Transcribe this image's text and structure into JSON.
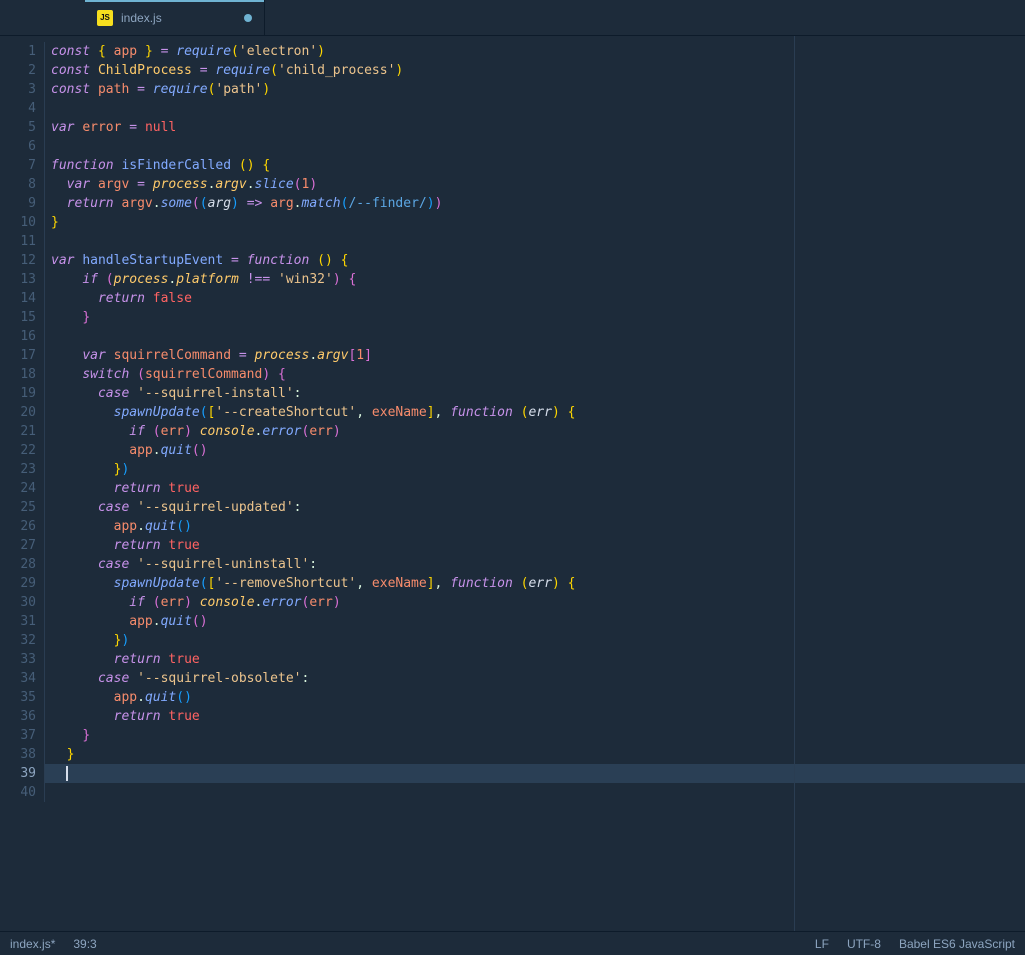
{
  "tab": {
    "label": "index.js",
    "icon": "JS",
    "dirty": true
  },
  "statusbar": {
    "filename": "index.js*",
    "cursor": "39:3",
    "eol": "LF",
    "encoding": "UTF-8",
    "grammar": "Babel ES6 JavaScript"
  },
  "editor": {
    "active_line": 39,
    "lines": [
      [
        [
          "kw",
          "const"
        ],
        [
          "pn",
          " "
        ],
        [
          "br",
          "{"
        ],
        [
          "pn",
          " "
        ],
        [
          "var",
          "app"
        ],
        [
          "pn",
          " "
        ],
        [
          "br",
          "}"
        ],
        [
          "pn",
          " "
        ],
        [
          "op",
          "="
        ],
        [
          "pn",
          " "
        ],
        [
          "fn",
          "require"
        ],
        [
          "br",
          "("
        ],
        [
          "str",
          "'electron'"
        ],
        [
          "br",
          ")"
        ]
      ],
      [
        [
          "kw",
          "const"
        ],
        [
          "pn",
          " "
        ],
        [
          "type",
          "ChildProcess"
        ],
        [
          "pn",
          " "
        ],
        [
          "op",
          "="
        ],
        [
          "pn",
          " "
        ],
        [
          "fn",
          "require"
        ],
        [
          "br",
          "("
        ],
        [
          "str",
          "'child_process'"
        ],
        [
          "br",
          ")"
        ]
      ],
      [
        [
          "kw",
          "const"
        ],
        [
          "pn",
          " "
        ],
        [
          "var",
          "path"
        ],
        [
          "pn",
          " "
        ],
        [
          "op",
          "="
        ],
        [
          "pn",
          " "
        ],
        [
          "fn",
          "require"
        ],
        [
          "br",
          "("
        ],
        [
          "str",
          "'path'"
        ],
        [
          "br",
          ")"
        ]
      ],
      [],
      [
        [
          "kw",
          "var"
        ],
        [
          "pn",
          " "
        ],
        [
          "var",
          "error"
        ],
        [
          "pn",
          " "
        ],
        [
          "op",
          "="
        ],
        [
          "pn",
          " "
        ],
        [
          "bool",
          "null"
        ]
      ],
      [],
      [
        [
          "kw",
          "function"
        ],
        [
          "pn",
          " "
        ],
        [
          "fn-def",
          "isFinderCalled"
        ],
        [
          "pn",
          " "
        ],
        [
          "br",
          "("
        ],
        [
          "br",
          ")"
        ],
        [
          "pn",
          " "
        ],
        [
          "br",
          "{"
        ]
      ],
      [
        [
          "pn",
          "  "
        ],
        [
          "kw",
          "var"
        ],
        [
          "pn",
          " "
        ],
        [
          "var",
          "argv"
        ],
        [
          "pn",
          " "
        ],
        [
          "op",
          "="
        ],
        [
          "pn",
          " "
        ],
        [
          "obj",
          "process"
        ],
        [
          "pn",
          "."
        ],
        [
          "obj",
          "argv"
        ],
        [
          "pn",
          "."
        ],
        [
          "fn",
          "slice"
        ],
        [
          "br2",
          "("
        ],
        [
          "num",
          "1"
        ],
        [
          "br2",
          ")"
        ]
      ],
      [
        [
          "pn",
          "  "
        ],
        [
          "kw",
          "return"
        ],
        [
          "pn",
          " "
        ],
        [
          "var",
          "argv"
        ],
        [
          "pn",
          "."
        ],
        [
          "fn",
          "some"
        ],
        [
          "br2",
          "("
        ],
        [
          "br3",
          "("
        ],
        [
          "param",
          "arg"
        ],
        [
          "br3",
          ")"
        ],
        [
          "pn",
          " "
        ],
        [
          "op",
          "=>"
        ],
        [
          "pn",
          " "
        ],
        [
          "var",
          "arg"
        ],
        [
          "pn",
          "."
        ],
        [
          "fn",
          "match"
        ],
        [
          "br3",
          "("
        ],
        [
          "reg",
          "/--finder/"
        ],
        [
          "br3",
          ")"
        ],
        [
          "br2",
          ")"
        ]
      ],
      [
        [
          "br",
          "}"
        ]
      ],
      [],
      [
        [
          "kw",
          "var"
        ],
        [
          "pn",
          " "
        ],
        [
          "fn-def",
          "handleStartupEvent"
        ],
        [
          "pn",
          " "
        ],
        [
          "op",
          "="
        ],
        [
          "pn",
          " "
        ],
        [
          "kw",
          "function"
        ],
        [
          "pn",
          " "
        ],
        [
          "br",
          "("
        ],
        [
          "br",
          ")"
        ],
        [
          "pn",
          " "
        ],
        [
          "br",
          "{"
        ]
      ],
      [
        [
          "pn",
          "    "
        ],
        [
          "kw",
          "if"
        ],
        [
          "pn",
          " "
        ],
        [
          "br2",
          "("
        ],
        [
          "obj",
          "process"
        ],
        [
          "pn",
          "."
        ],
        [
          "obj",
          "platform"
        ],
        [
          "pn",
          " "
        ],
        [
          "op",
          "!=="
        ],
        [
          "pn",
          " "
        ],
        [
          "str",
          "'win32'"
        ],
        [
          "br2",
          ")"
        ],
        [
          "pn",
          " "
        ],
        [
          "br2",
          "{"
        ]
      ],
      [
        [
          "pn",
          "      "
        ],
        [
          "kw",
          "return"
        ],
        [
          "pn",
          " "
        ],
        [
          "bool",
          "false"
        ]
      ],
      [
        [
          "pn",
          "    "
        ],
        [
          "br2",
          "}"
        ]
      ],
      [],
      [
        [
          "pn",
          "    "
        ],
        [
          "kw",
          "var"
        ],
        [
          "pn",
          " "
        ],
        [
          "var",
          "squirrelCommand"
        ],
        [
          "pn",
          " "
        ],
        [
          "op",
          "="
        ],
        [
          "pn",
          " "
        ],
        [
          "obj",
          "process"
        ],
        [
          "pn",
          "."
        ],
        [
          "obj",
          "argv"
        ],
        [
          "br2",
          "["
        ],
        [
          "num",
          "1"
        ],
        [
          "br2",
          "]"
        ]
      ],
      [
        [
          "pn",
          "    "
        ],
        [
          "kw",
          "switch"
        ],
        [
          "pn",
          " "
        ],
        [
          "br2",
          "("
        ],
        [
          "var",
          "squirrelCommand"
        ],
        [
          "br2",
          ")"
        ],
        [
          "pn",
          " "
        ],
        [
          "br2",
          "{"
        ]
      ],
      [
        [
          "pn",
          "      "
        ],
        [
          "kw",
          "case"
        ],
        [
          "pn",
          " "
        ],
        [
          "str",
          "'--squirrel-install'"
        ],
        [
          "pn",
          ":"
        ]
      ],
      [
        [
          "pn",
          "        "
        ],
        [
          "fn",
          "spawnUpdate"
        ],
        [
          "br3",
          "("
        ],
        [
          "br",
          "["
        ],
        [
          "str",
          "'--createShortcut'"
        ],
        [
          "pn",
          ", "
        ],
        [
          "var",
          "exeName"
        ],
        [
          "br",
          "]"
        ],
        [
          "pn",
          ", "
        ],
        [
          "kw",
          "function"
        ],
        [
          "pn",
          " "
        ],
        [
          "br",
          "("
        ],
        [
          "param",
          "err"
        ],
        [
          "br",
          ")"
        ],
        [
          "pn",
          " "
        ],
        [
          "br",
          "{"
        ]
      ],
      [
        [
          "pn",
          "          "
        ],
        [
          "kw",
          "if"
        ],
        [
          "pn",
          " "
        ],
        [
          "br2",
          "("
        ],
        [
          "var",
          "err"
        ],
        [
          "br2",
          ")"
        ],
        [
          "pn",
          " "
        ],
        [
          "obj",
          "console"
        ],
        [
          "pn",
          "."
        ],
        [
          "fn",
          "error"
        ],
        [
          "br2",
          "("
        ],
        [
          "var",
          "err"
        ],
        [
          "br2",
          ")"
        ]
      ],
      [
        [
          "pn",
          "          "
        ],
        [
          "var",
          "app"
        ],
        [
          "pn",
          "."
        ],
        [
          "fn",
          "quit"
        ],
        [
          "br2",
          "("
        ],
        [
          "br2",
          ")"
        ]
      ],
      [
        [
          "pn",
          "        "
        ],
        [
          "br",
          "}"
        ],
        [
          "br3",
          ")"
        ]
      ],
      [
        [
          "pn",
          "        "
        ],
        [
          "kw",
          "return"
        ],
        [
          "pn",
          " "
        ],
        [
          "bool",
          "true"
        ]
      ],
      [
        [
          "pn",
          "      "
        ],
        [
          "kw",
          "case"
        ],
        [
          "pn",
          " "
        ],
        [
          "str",
          "'--squirrel-updated'"
        ],
        [
          "pn",
          ":"
        ]
      ],
      [
        [
          "pn",
          "        "
        ],
        [
          "var",
          "app"
        ],
        [
          "pn",
          "."
        ],
        [
          "fn",
          "quit"
        ],
        [
          "br3",
          "("
        ],
        [
          "br3",
          ")"
        ]
      ],
      [
        [
          "pn",
          "        "
        ],
        [
          "kw",
          "return"
        ],
        [
          "pn",
          " "
        ],
        [
          "bool",
          "true"
        ]
      ],
      [
        [
          "pn",
          "      "
        ],
        [
          "kw",
          "case"
        ],
        [
          "pn",
          " "
        ],
        [
          "str",
          "'--squirrel-uninstall'"
        ],
        [
          "pn",
          ":"
        ]
      ],
      [
        [
          "pn",
          "        "
        ],
        [
          "fn",
          "spawnUpdate"
        ],
        [
          "br3",
          "("
        ],
        [
          "br",
          "["
        ],
        [
          "str",
          "'--removeShortcut'"
        ],
        [
          "pn",
          ", "
        ],
        [
          "var",
          "exeName"
        ],
        [
          "br",
          "]"
        ],
        [
          "pn",
          ", "
        ],
        [
          "kw",
          "function"
        ],
        [
          "pn",
          " "
        ],
        [
          "br",
          "("
        ],
        [
          "param",
          "err"
        ],
        [
          "br",
          ")"
        ],
        [
          "pn",
          " "
        ],
        [
          "br",
          "{"
        ]
      ],
      [
        [
          "pn",
          "          "
        ],
        [
          "kw",
          "if"
        ],
        [
          "pn",
          " "
        ],
        [
          "br2",
          "("
        ],
        [
          "var",
          "err"
        ],
        [
          "br2",
          ")"
        ],
        [
          "pn",
          " "
        ],
        [
          "obj",
          "console"
        ],
        [
          "pn",
          "."
        ],
        [
          "fn",
          "error"
        ],
        [
          "br2",
          "("
        ],
        [
          "var",
          "err"
        ],
        [
          "br2",
          ")"
        ]
      ],
      [
        [
          "pn",
          "          "
        ],
        [
          "var",
          "app"
        ],
        [
          "pn",
          "."
        ],
        [
          "fn",
          "quit"
        ],
        [
          "br2",
          "("
        ],
        [
          "br2",
          ")"
        ]
      ],
      [
        [
          "pn",
          "        "
        ],
        [
          "br",
          "}"
        ],
        [
          "br3",
          ")"
        ]
      ],
      [
        [
          "pn",
          "        "
        ],
        [
          "kw",
          "return"
        ],
        [
          "pn",
          " "
        ],
        [
          "bool",
          "true"
        ]
      ],
      [
        [
          "pn",
          "      "
        ],
        [
          "kw",
          "case"
        ],
        [
          "pn",
          " "
        ],
        [
          "str",
          "'--squirrel-obsolete'"
        ],
        [
          "pn",
          ":"
        ]
      ],
      [
        [
          "pn",
          "        "
        ],
        [
          "var",
          "app"
        ],
        [
          "pn",
          "."
        ],
        [
          "fn",
          "quit"
        ],
        [
          "br3",
          "("
        ],
        [
          "br3",
          ")"
        ]
      ],
      [
        [
          "pn",
          "        "
        ],
        [
          "kw",
          "return"
        ],
        [
          "pn",
          " "
        ],
        [
          "bool",
          "true"
        ]
      ],
      [
        [
          "pn",
          "    "
        ],
        [
          "br2",
          "}"
        ]
      ],
      [
        [
          "pn",
          "  "
        ],
        [
          "br",
          "}"
        ]
      ],
      [
        [
          "pn",
          "  "
        ]
      ],
      []
    ]
  }
}
